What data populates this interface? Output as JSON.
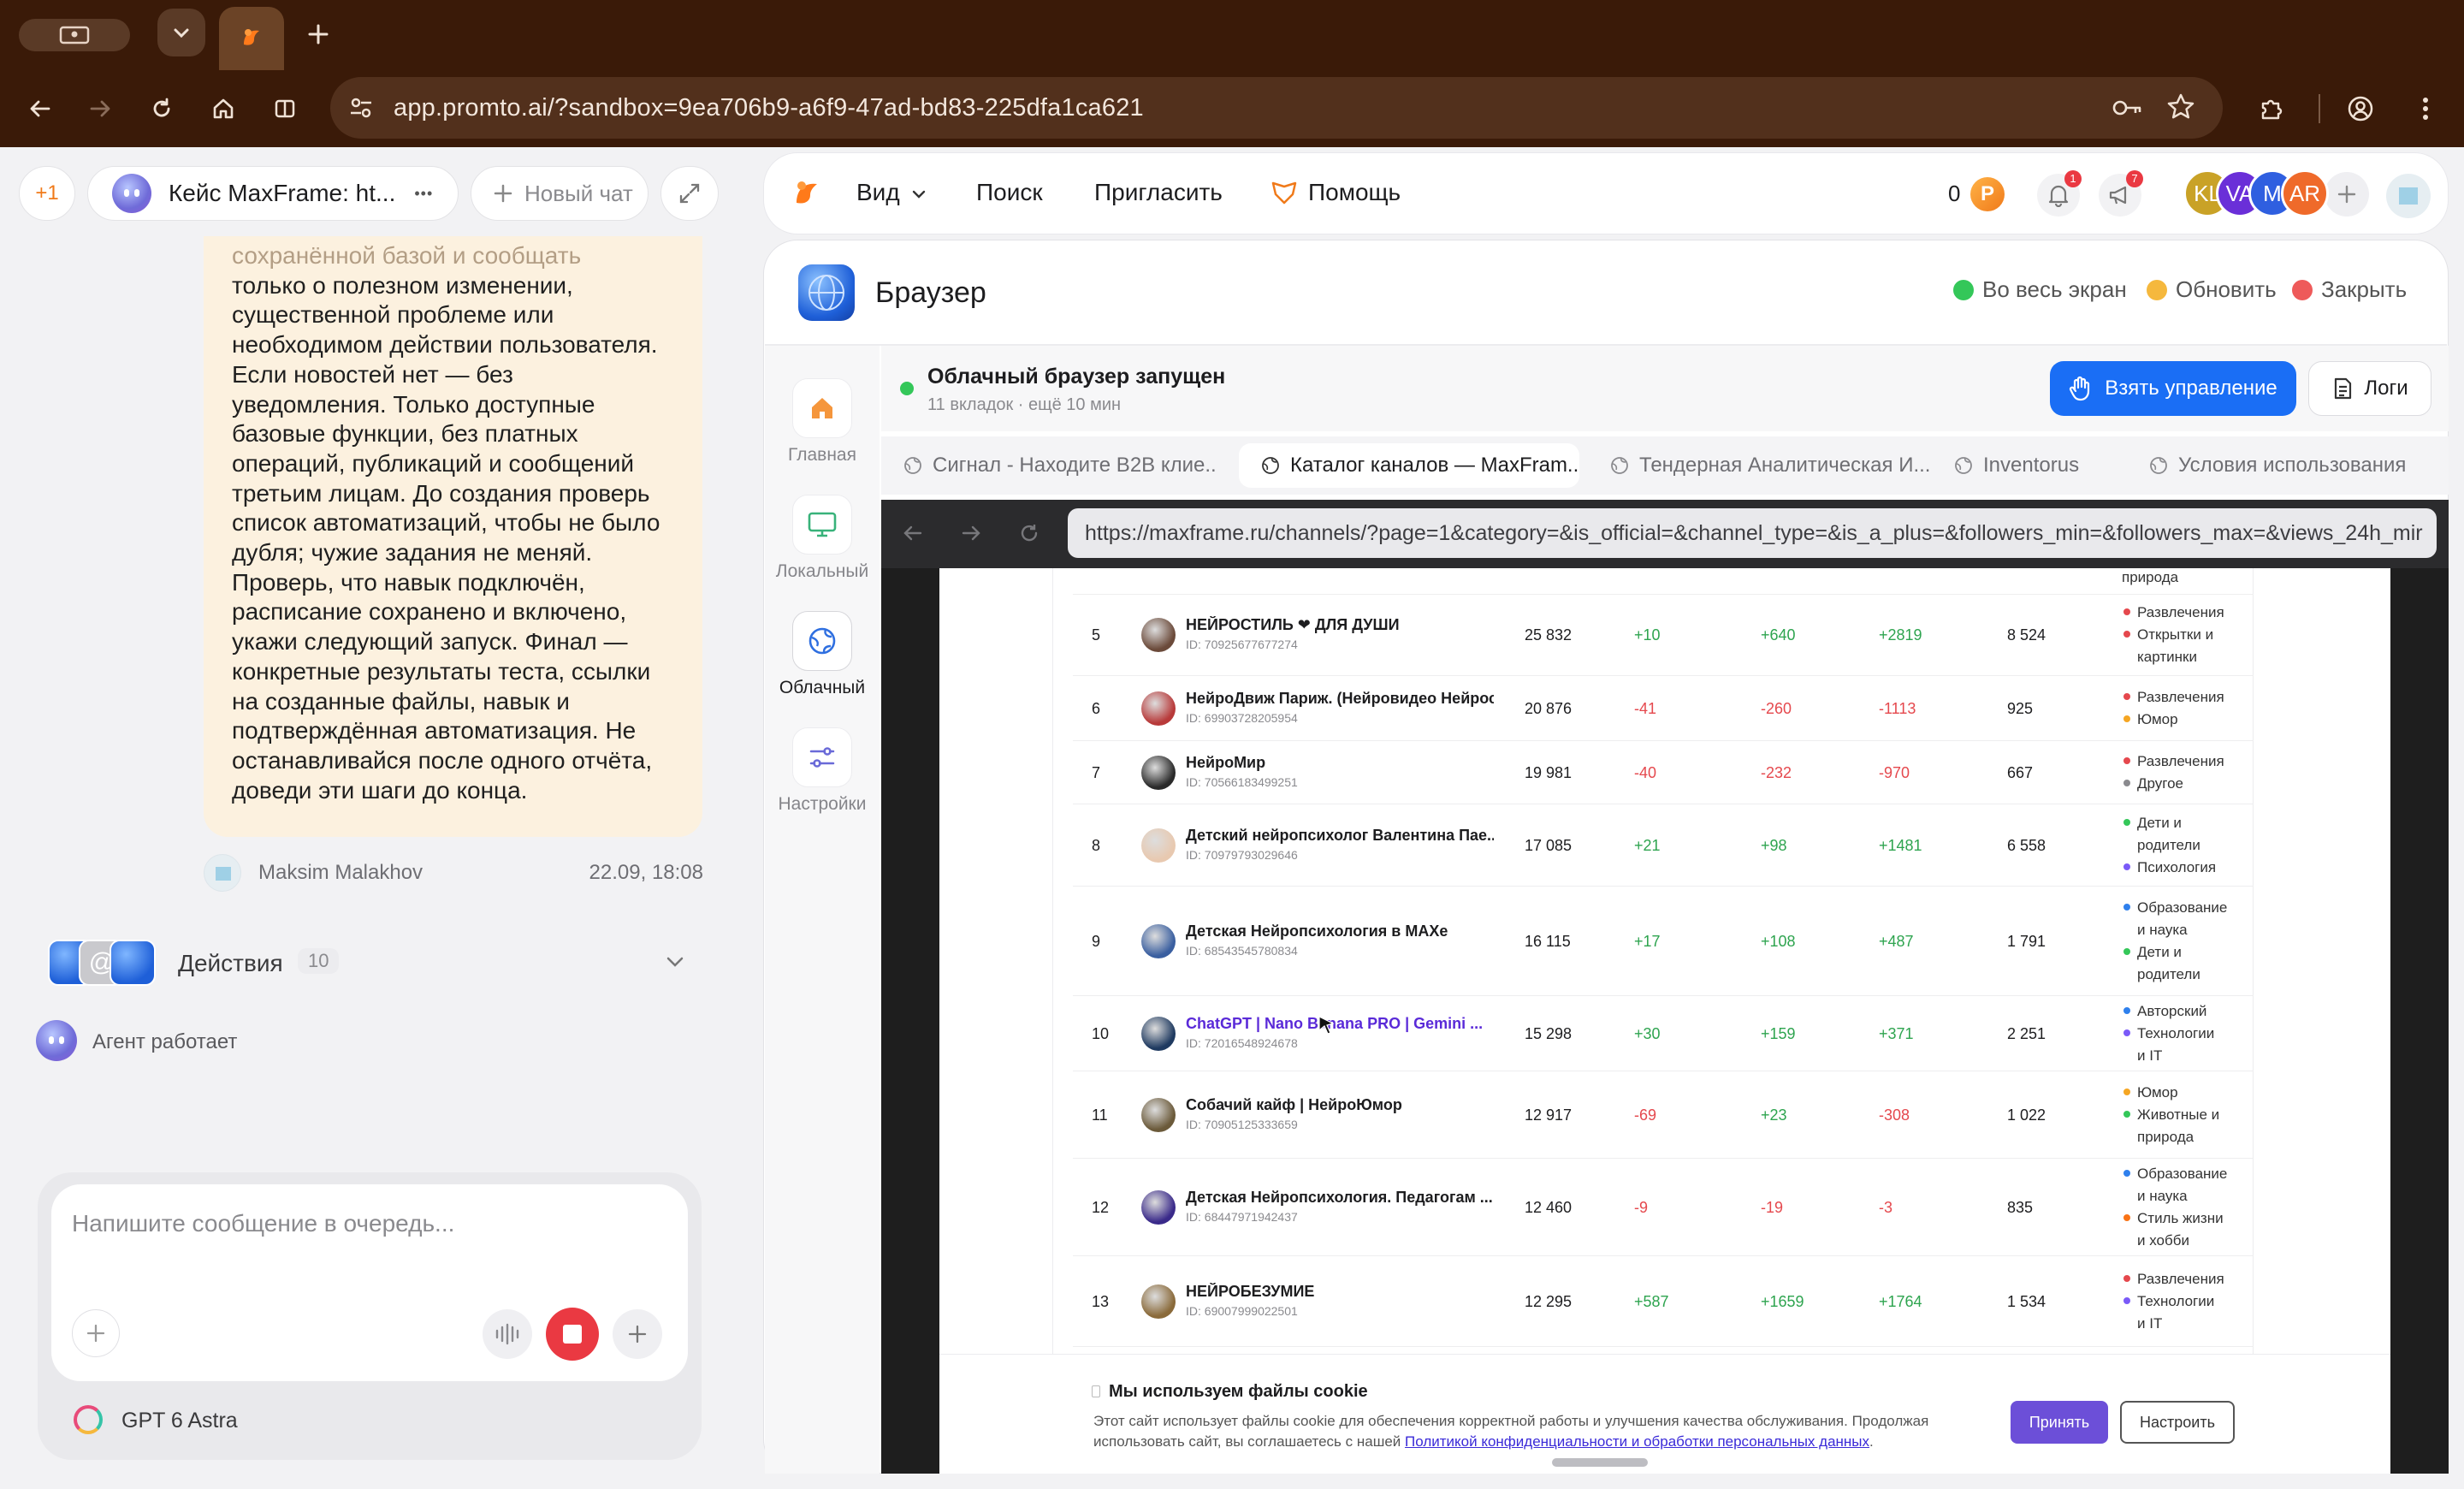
{
  "chrome": {
    "url": "app.promto.ai/?sandbox=9ea706b9-a6f9-47ad-bd83-225dfa1ca621"
  },
  "left": {
    "badge_count": "+1",
    "chat_tab_title": "Кейс MaxFrame: ht...",
    "more_label": "•••",
    "new_chat_label": "Новый чат",
    "message_lines": [
      "сохранённой базой и сообщать",
      "только о полезном изменении,",
      "существенной проблеме или",
      "необходимом действии пользователя.",
      "Если новостей нет — без",
      "уведомления. Только доступные",
      "базовые функции, без платных",
      "операций, публикаций и сообщений",
      "третьим лицам. До создания проверь",
      "список автоматизаций, чтобы не было",
      "дубля; чужие задания не меняй.",
      "Проверь, что навык подключён,",
      "расписание сохранено и включено,",
      "укажи следующий запуск. Финал —",
      "конкретные результаты теста, ссылки",
      "на созданные файлы, навык и",
      "подтверждённая автоматизация. Не",
      "останавливайся после одного отчёта,",
      "доведи эти шаги до конца."
    ],
    "author": "Maksim Malakhov",
    "timestamp": "22.09, 18:08",
    "actions_label": "Действия",
    "actions_count": "10",
    "agent_status": "Агент работает",
    "composer_placeholder": "Напишите сообщение в очередь...",
    "model_name": "GPT 6 Astra"
  },
  "topbar": {
    "view_label": "Вид",
    "search_label": "Поиск",
    "invite_label": "Пригласить",
    "help_label": "Помощь",
    "credits": "0",
    "notif_count": "1",
    "announce_count": "7",
    "avatars": [
      "KL",
      "VA",
      "M",
      "AR"
    ]
  },
  "browser": {
    "title": "Браузер",
    "fullscreen_label": "Во весь экран",
    "refresh_label": "Обновить",
    "close_label": "Закрыть",
    "sidenav": [
      "Главная",
      "Локальный",
      "Облачный",
      "Настройки"
    ],
    "status_title": "Облачный браузер запущен",
    "status_sub": "11 вкладок · ещё 10 мин",
    "take_control_label": "Взять управление",
    "logs_label": "Логи",
    "tabs": [
      "Сигнал - Находите B2B клие...",
      "Каталог каналов — MaxFram...",
      "Тендерная Аналитическая И...",
      "Inventorus",
      "Условия использования"
    ],
    "url": "https://maxframe.ru/channels/?page=1&category=&is_official=&channel_type=&is_a_plus=&followers_min=&followers_max=&views_24h_mir"
  },
  "table": {
    "top_tag": "природа",
    "rows": [
      {
        "n": "5",
        "name": "НЕЙРОСТИЛЬ ❤ ДЛЯ ДУШИ",
        "id": "ID: 70925677677274",
        "subs": "25 832",
        "d1": "+10",
        "d7": "+640",
        "d30": "+2819",
        "views": "8 524",
        "tags": [
          [
            "Развлечения",
            "#e5484d"
          ],
          [
            "Открытки и",
            "#e5484d"
          ],
          [
            "картинки",
            ""
          ]
        ]
      },
      {
        "n": "6",
        "name": "НейроДвиж Париж. (Нейровидео Нейрос...",
        "id": "ID: 69903728205954",
        "subs": "20 876",
        "d1": "-41",
        "d7": "-260",
        "d30": "-1113",
        "views": "925",
        "tags": [
          [
            "Развлечения",
            "#e5484d"
          ],
          [
            "Юмор",
            "#f5a623"
          ]
        ]
      },
      {
        "n": "7",
        "name": "НейроМир",
        "id": "ID: 70566183499251",
        "subs": "19 981",
        "d1": "-40",
        "d7": "-232",
        "d30": "-970",
        "views": "667",
        "tags": [
          [
            "Развлечения",
            "#e5484d"
          ],
          [
            "Другое",
            "#8a8a8e"
          ]
        ]
      },
      {
        "n": "8",
        "name": "Детский нейропсихолог Валентина Пае...",
        "id": "ID: 70979793029646",
        "subs": "17 085",
        "d1": "+21",
        "d7": "+98",
        "d30": "+1481",
        "views": "6 558",
        "tags": [
          [
            "Дети и",
            "#34c759"
          ],
          [
            "родители",
            ""
          ],
          [
            "Психология",
            "#7a5af8"
          ]
        ]
      },
      {
        "n": "9",
        "name": "Детская Нейропсихология в MAXe",
        "id": "ID: 68543545780834",
        "subs": "16 115",
        "d1": "+17",
        "d7": "+108",
        "d30": "+487",
        "views": "1 791",
        "tags": [
          [
            "Образование",
            "#2f80ed"
          ],
          [
            "и наука",
            ""
          ],
          [
            "Дети и",
            "#34c759"
          ],
          [
            "родители",
            ""
          ]
        ]
      },
      {
        "n": "10",
        "name": "ChatGPT | Nano Banana PRO | Gemini ...",
        "id": "ID: 72016548924678",
        "subs": "15 298",
        "d1": "+30",
        "d7": "+159",
        "d30": "+371",
        "views": "2 251",
        "link": true,
        "tags": [
          [
            "Авторский",
            "#2f80ed"
          ],
          [
            "Технологии",
            "#7a5af8"
          ],
          [
            "и IT",
            ""
          ]
        ]
      },
      {
        "n": "11",
        "name": "Собачий кайф | НейроЮмор",
        "id": "ID: 70905125333659",
        "subs": "12 917",
        "d1": "-69",
        "d7": "+23",
        "d30": "-308",
        "views": "1 022",
        "tags": [
          [
            "Юмор",
            "#f5a623"
          ],
          [
            "Животные и",
            "#34c759"
          ],
          [
            "природа",
            ""
          ]
        ]
      },
      {
        "n": "12",
        "name": "Детская Нейропсихология. Педагогам ...",
        "id": "ID: 68447971942437",
        "subs": "12 460",
        "d1": "-9",
        "d7": "-19",
        "d30": "-3",
        "views": "835",
        "tags": [
          [
            "Образование",
            "#2f80ed"
          ],
          [
            "и наука",
            ""
          ],
          [
            "Стиль жизни",
            "#f97316"
          ],
          [
            "и хобби",
            ""
          ]
        ]
      },
      {
        "n": "13",
        "name": "НЕЙРОБЕЗУМИЕ",
        "id": "ID: 69007999022501",
        "subs": "12 295",
        "d1": "+587",
        "d7": "+1659",
        "d30": "+1764",
        "views": "1 534",
        "tags": [
          [
            "Развлечения",
            "#e5484d"
          ],
          [
            "Технологии",
            "#7a5af8"
          ],
          [
            "и IT",
            ""
          ]
        ]
      }
    ]
  },
  "cookie": {
    "title": "Мы используем файлы cookie",
    "text": "Этот сайт использует файлы cookie для обеспечения корректной работы и улучшения качества обслуживания. Продолжая",
    "text2": "использовать сайт, вы соглашаетесь с нашей",
    "link": "Политикой конфиденциальности и обработки персональных данных",
    "accept_label": "Принять",
    "settings_label": "Настроить"
  }
}
